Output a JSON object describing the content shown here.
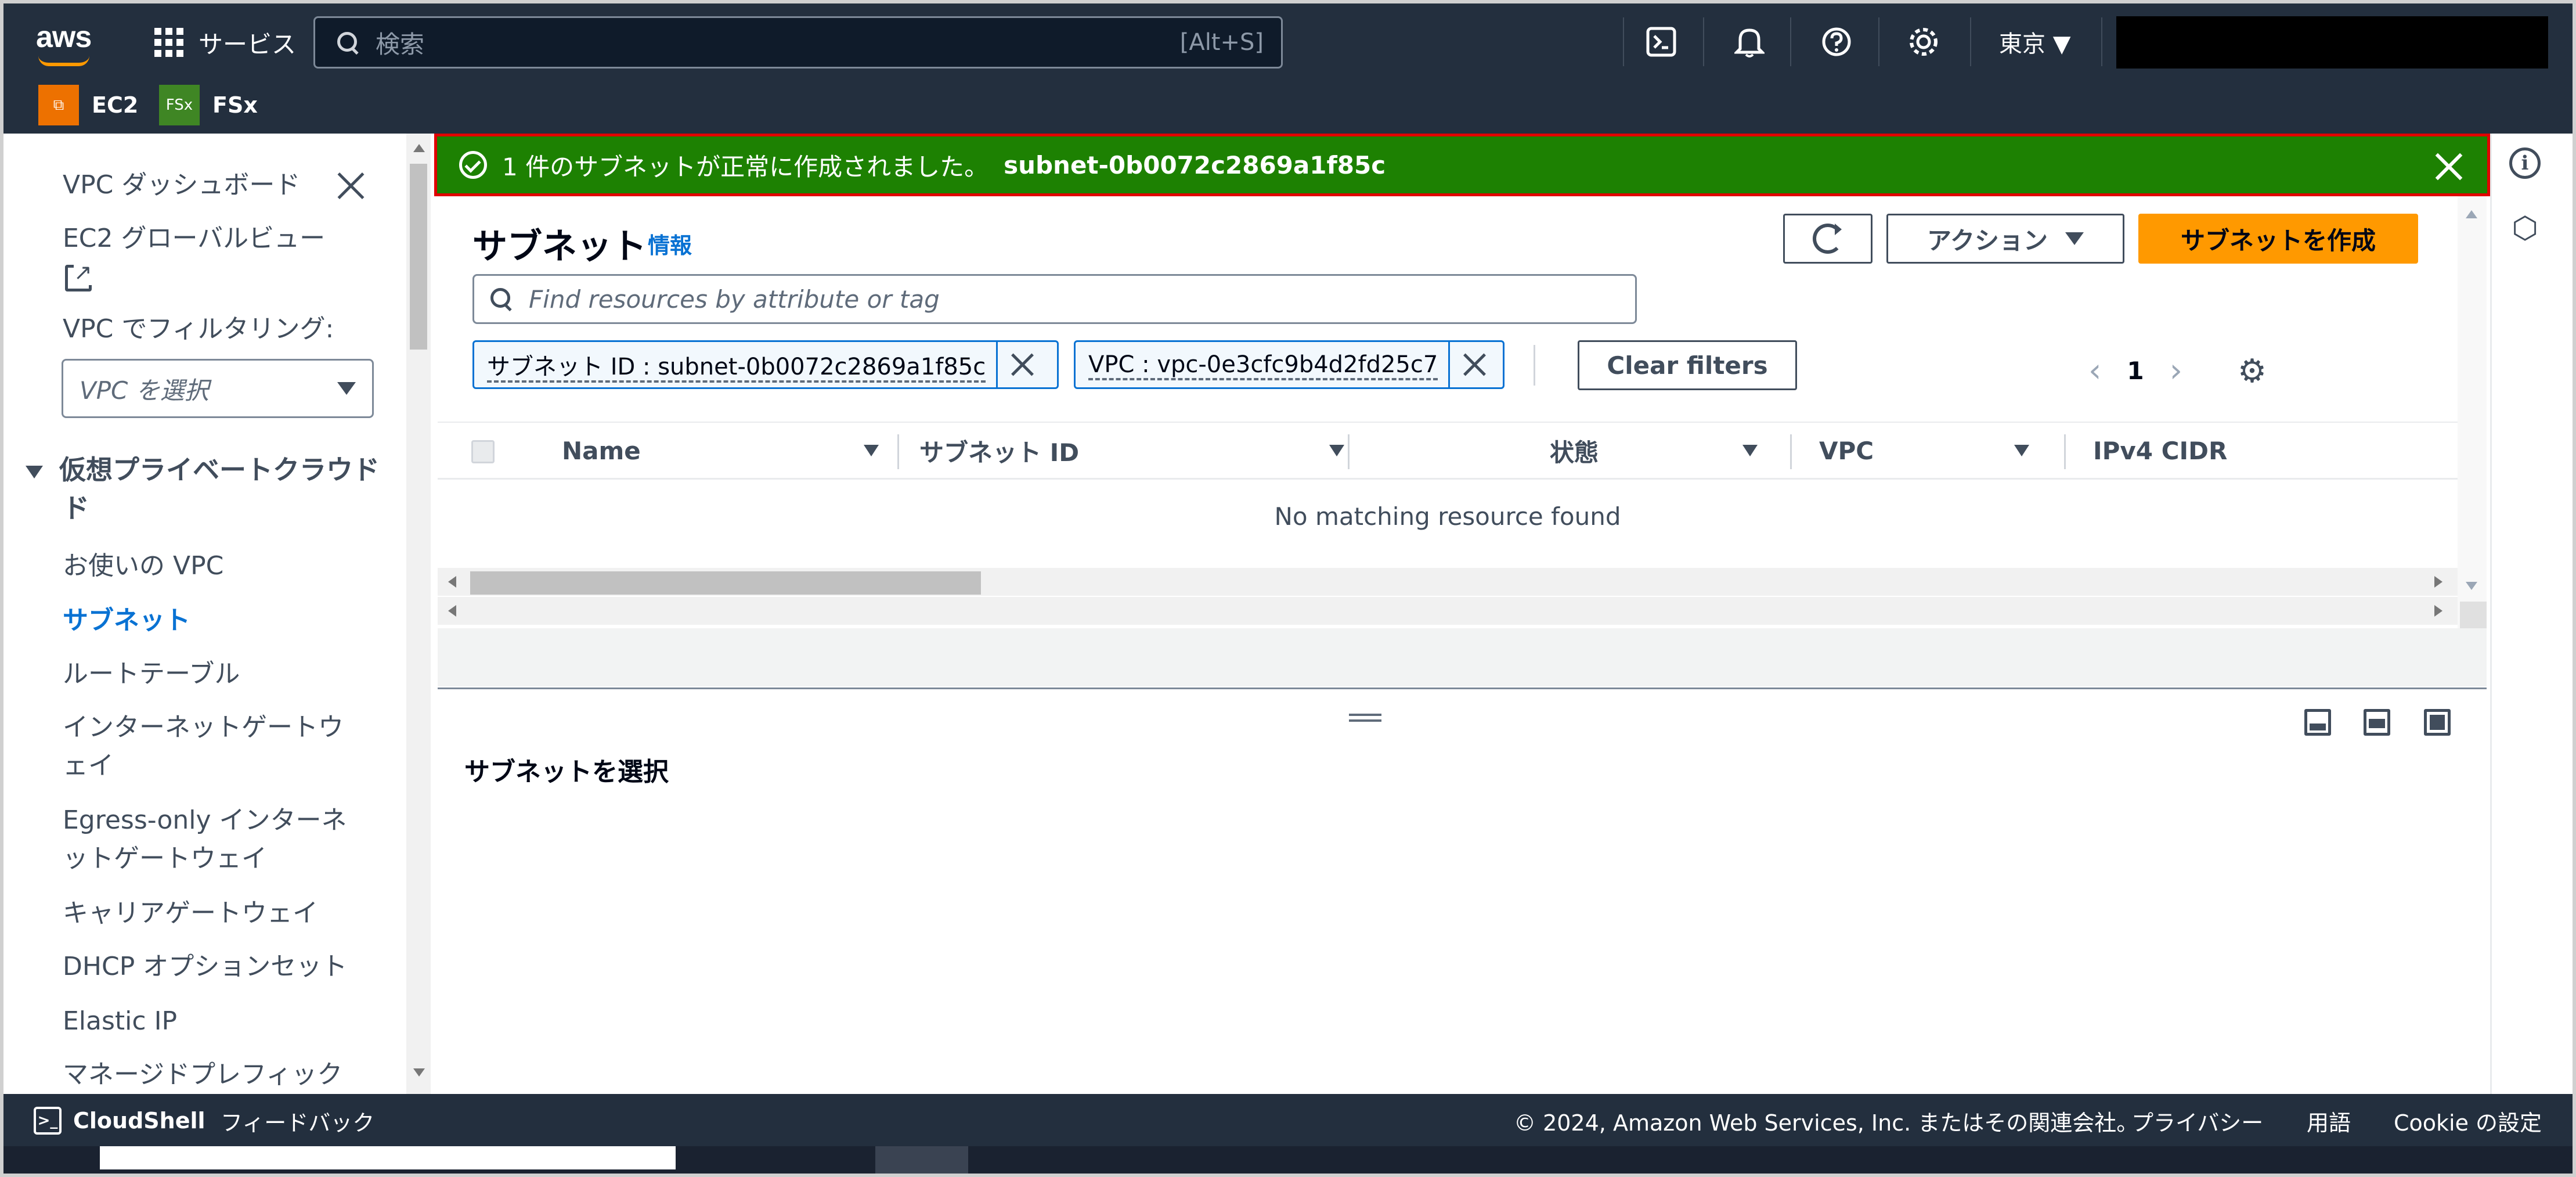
{
  "topnav": {
    "logo_text": "aws",
    "services_label": "サービス",
    "search_placeholder": "検索",
    "search_shortcut": "[Alt+S]",
    "region": "東京 ▼",
    "icons": [
      "cloudshell-icon",
      "bell-icon",
      "help-icon",
      "gear-icon"
    ]
  },
  "favorites": [
    {
      "label": "EC2",
      "icon_text": "⧉"
    },
    {
      "label": "FSx",
      "icon_text": "FSx"
    }
  ],
  "sidebar": {
    "dashboard": "VPC ダッシュボード",
    "global_view": "EC2 グローバルビュー",
    "filter_label": "VPC でフィルタリング:",
    "filter_placeholder": "VPC を選択",
    "section": "仮想プライベートクラウド",
    "section_line2": "ド",
    "items": [
      {
        "label": "お使いの VPC"
      },
      {
        "label": "サブネット",
        "active": true
      },
      {
        "label": "ルートテーブル"
      },
      {
        "label": "インターネットゲートウ"
      },
      {
        "label": "ェイ"
      },
      {
        "label": "Egress-only インターネ"
      },
      {
        "label": "ットゲートウェイ"
      },
      {
        "label": "キャリアゲートウェイ"
      },
      {
        "label": "DHCP オプションセット"
      },
      {
        "label": "Elastic IP"
      },
      {
        "label": "マネージドプレフィック"
      }
    ]
  },
  "flash": {
    "message": "1 件のサブネットが正常に作成されました。",
    "resource_id": "subnet-0b0072c2869a1f85c"
  },
  "panel": {
    "title": "サブネット",
    "info_link": "情報",
    "actions_label": "アクション",
    "create_label": "サブネットを作成",
    "filter_placeholder": "Find resources by attribute or tag",
    "tokens": [
      {
        "label": "サブネット ID : subnet-0b0072c2869a1f85c"
      },
      {
        "label": "VPC : vpc-0e3cfc9b4d2fd25c7"
      }
    ],
    "clear_filters": "Clear filters",
    "page": "1",
    "columns": [
      "Name",
      "サブネット ID",
      "状態",
      "VPC",
      "IPv4 CIDR"
    ],
    "empty_message": "No matching resource found"
  },
  "split_panel": {
    "title": "サブネットを選択"
  },
  "footer": {
    "cloudshell": "CloudShell",
    "feedback": "フィードバック",
    "copyright": "© 2024, Amazon Web Services, Inc. またはその関連会社。",
    "privacy": "プライバシー",
    "terms": "用語",
    "cookie": "Cookie の設定"
  },
  "colors": {
    "nav_bg": "#232f3e",
    "success": "#1d8102",
    "highlight_border": "#e10000",
    "primary_button": "#ff9900",
    "link": "#0972d3"
  }
}
